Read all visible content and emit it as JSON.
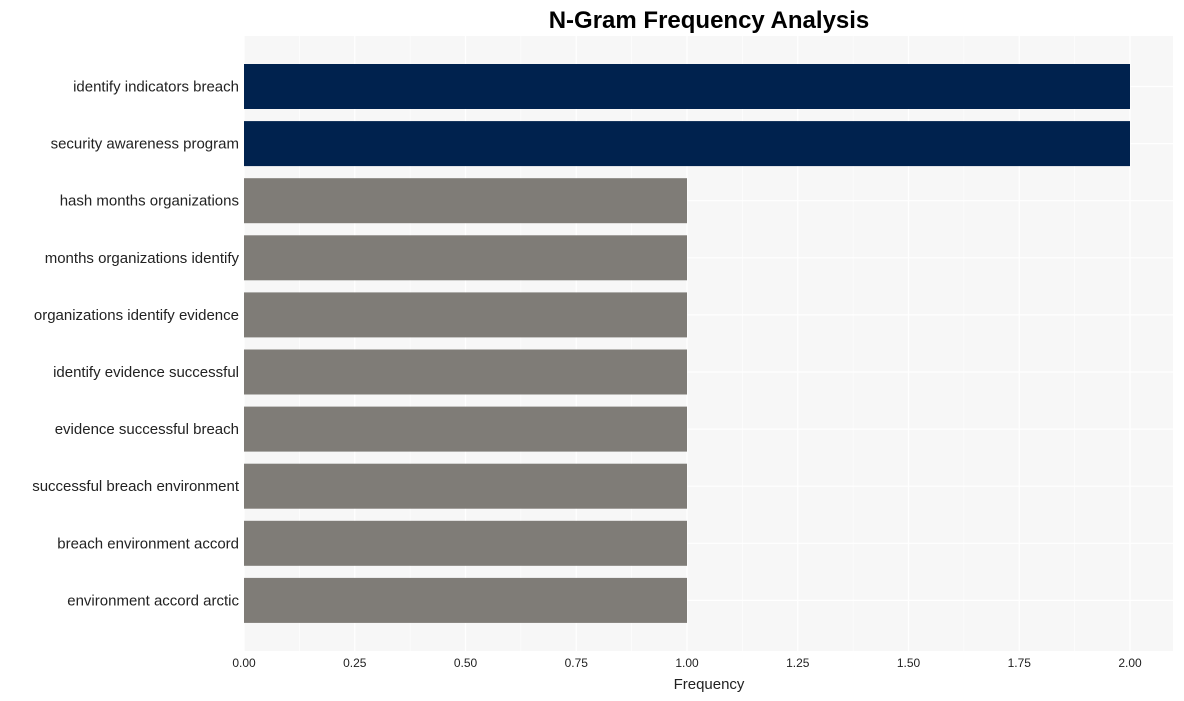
{
  "chart_data": {
    "type": "bar",
    "orientation": "horizontal",
    "title": "N-Gram Frequency Analysis",
    "xlabel": "Frequency",
    "ylabel": "",
    "xlim": [
      0,
      2.1
    ],
    "x_ticks": [
      "0.00",
      "0.25",
      "0.50",
      "0.75",
      "1.00",
      "1.25",
      "1.50",
      "1.75",
      "2.00"
    ],
    "x_tick_values": [
      0,
      0.25,
      0.5,
      0.75,
      1.0,
      1.25,
      1.5,
      1.75,
      2.0
    ],
    "grid": true,
    "legend": "none",
    "categories": [
      "identify indicators breach",
      "security awareness program",
      "hash months organizations",
      "months organizations identify",
      "organizations identify evidence",
      "identify evidence successful",
      "evidence successful breach",
      "successful breach environment",
      "breach environment accord",
      "environment accord arctic"
    ],
    "values": [
      2,
      2,
      1,
      1,
      1,
      1,
      1,
      1,
      1,
      1
    ],
    "colors": {
      "highlight": "#00224e",
      "default": "#7f7c77",
      "background": "#f7f7f7",
      "grid": "#ffffff"
    }
  }
}
